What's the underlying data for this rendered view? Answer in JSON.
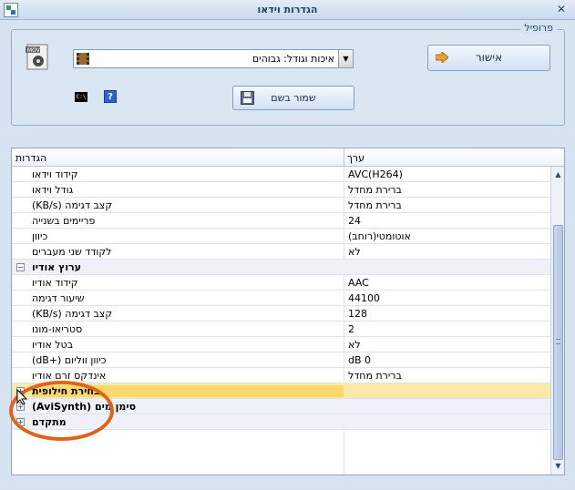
{
  "window": {
    "title": "הגדרות וידאו",
    "close_glyph": "✕"
  },
  "profile": {
    "group_label": "פרופיל",
    "selected_profile": "איכות וגודל: גבוהים",
    "ok_label": "אישור",
    "save_label": "שמור בשם"
  },
  "grid": {
    "header": {
      "settings": "הגדרות",
      "value": "ערך"
    },
    "rows": [
      {
        "name": "קידוד וידאו",
        "value": "AVC(H264)"
      },
      {
        "name": "גודל וידאו",
        "value": "ברירת מחדל"
      },
      {
        "name": "קצב דגימה (KB/s)",
        "value": "ברירת מחדל"
      },
      {
        "name": "פריימים בשנייה",
        "value": "24"
      },
      {
        "name": "כיוון",
        "value": "אוטומטי(רוחב)"
      },
      {
        "name": "לקודד שני מעברים",
        "value": "לא"
      },
      {
        "name": "ערוץ אודיו",
        "value": ""
      },
      {
        "name": "קידוד אודיו",
        "value": "AAC"
      },
      {
        "name": "שיעור דגימה",
        "value": "44100"
      },
      {
        "name": "קצב דגימה (KB/s)",
        "value": "128"
      },
      {
        "name": "סטריאו-מונו",
        "value": "2"
      },
      {
        "name": "בטל אודיו",
        "value": "לא"
      },
      {
        "name": "כיוון ווליום (+dB)",
        "value": "0 dB"
      },
      {
        "name": "אינדקס זרם אודיו",
        "value": "ברירת מחדל"
      },
      {
        "name": "בחירת חילופית",
        "value": ""
      },
      {
        "name": "סימן מים (AviSynth)",
        "value": ""
      },
      {
        "name": "מתקדם",
        "value": ""
      }
    ]
  }
}
